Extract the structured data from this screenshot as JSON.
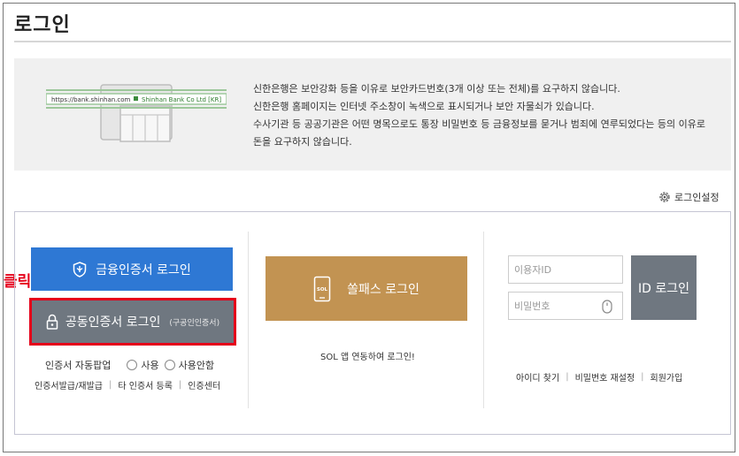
{
  "page": {
    "title": "로그인"
  },
  "notice": {
    "browser_url": "https://bank.shinhan.com",
    "browser_cert": "Shinhan Bank Co Ltd [KR]",
    "lines": [
      "신한은행은 보안강화 등을 이유로 보안카드번호(3개 이상 또는 전체)를 요구하지 않습니다.",
      "신한은행 홈페이지는 인터넷 주소창이 녹색으로 표시되거나 보안 자물쇠가 있습니다.",
      "수사기관 등 공공기관은 어떤 명목으로도 통장 비밀번호 등 금융정보를 묻거나 범죄에 연루되었다는 등의 이유로 돈을 요구하지 않습니다."
    ]
  },
  "settings": {
    "label": "로그인설정",
    "icon": "gear-icon"
  },
  "annotation": {
    "click_label": "클릭",
    "color": "#e5001a"
  },
  "cert": {
    "financial_label": "금융인증서 로그인",
    "joint_label": "공동인증서 로그인",
    "joint_sub": "(구공인인증서)",
    "popup_label": "인증서 자동팝업",
    "popup_options": [
      "사용",
      "사용안함"
    ],
    "links": [
      "인증서발급/재발급",
      "타 인증서 등록",
      "인증센터"
    ]
  },
  "sol": {
    "label": "쏠패스 로그인",
    "caption": "SOL 앱 연동하여 로그인!",
    "icon_text": "SOL"
  },
  "id_login": {
    "id_placeholder": "이용자ID",
    "pw_placeholder": "비밀번호",
    "button_label": "ID 로그인",
    "links": [
      "아이디 찾기",
      "비밀번호 재설정",
      "회원가입"
    ]
  },
  "colors": {
    "financial": "#2e78d4",
    "joint": "#6f7780",
    "sol": "#c29352",
    "id_button": "#6f7780",
    "notice_bg": "#f0f0f0"
  }
}
